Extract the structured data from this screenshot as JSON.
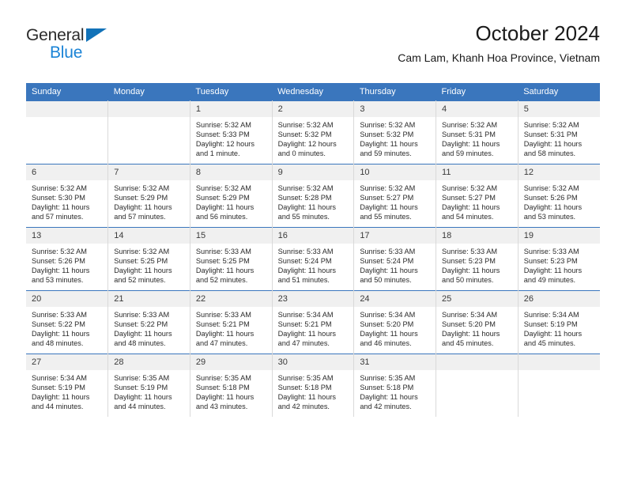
{
  "brand": {
    "name_part1": "General",
    "name_part2": "Blue",
    "logo_icon": "triangle-icon",
    "accent_blue": "#1a83d6",
    "triangle_blue": "#1272b8",
    "header_blue": "#3a76bd"
  },
  "header": {
    "title": "October 2024",
    "subtitle": "Cam Lam, Khanh Hoa Province, Vietnam"
  },
  "weekday_headers": [
    "Sunday",
    "Monday",
    "Tuesday",
    "Wednesday",
    "Thursday",
    "Friday",
    "Saturday"
  ],
  "weeks": [
    [
      {
        "day": "",
        "sunrise": "",
        "sunset": "",
        "daylight_line1": "",
        "daylight_line2": ""
      },
      {
        "day": "",
        "sunrise": "",
        "sunset": "",
        "daylight_line1": "",
        "daylight_line2": ""
      },
      {
        "day": "1",
        "sunrise": "Sunrise: 5:32 AM",
        "sunset": "Sunset: 5:33 PM",
        "daylight_line1": "Daylight: 12 hours",
        "daylight_line2": "and 1 minute."
      },
      {
        "day": "2",
        "sunrise": "Sunrise: 5:32 AM",
        "sunset": "Sunset: 5:32 PM",
        "daylight_line1": "Daylight: 12 hours",
        "daylight_line2": "and 0 minutes."
      },
      {
        "day": "3",
        "sunrise": "Sunrise: 5:32 AM",
        "sunset": "Sunset: 5:32 PM",
        "daylight_line1": "Daylight: 11 hours",
        "daylight_line2": "and 59 minutes."
      },
      {
        "day": "4",
        "sunrise": "Sunrise: 5:32 AM",
        "sunset": "Sunset: 5:31 PM",
        "daylight_line1": "Daylight: 11 hours",
        "daylight_line2": "and 59 minutes."
      },
      {
        "day": "5",
        "sunrise": "Sunrise: 5:32 AM",
        "sunset": "Sunset: 5:31 PM",
        "daylight_line1": "Daylight: 11 hours",
        "daylight_line2": "and 58 minutes."
      }
    ],
    [
      {
        "day": "6",
        "sunrise": "Sunrise: 5:32 AM",
        "sunset": "Sunset: 5:30 PM",
        "daylight_line1": "Daylight: 11 hours",
        "daylight_line2": "and 57 minutes."
      },
      {
        "day": "7",
        "sunrise": "Sunrise: 5:32 AM",
        "sunset": "Sunset: 5:29 PM",
        "daylight_line1": "Daylight: 11 hours",
        "daylight_line2": "and 57 minutes."
      },
      {
        "day": "8",
        "sunrise": "Sunrise: 5:32 AM",
        "sunset": "Sunset: 5:29 PM",
        "daylight_line1": "Daylight: 11 hours",
        "daylight_line2": "and 56 minutes."
      },
      {
        "day": "9",
        "sunrise": "Sunrise: 5:32 AM",
        "sunset": "Sunset: 5:28 PM",
        "daylight_line1": "Daylight: 11 hours",
        "daylight_line2": "and 55 minutes."
      },
      {
        "day": "10",
        "sunrise": "Sunrise: 5:32 AM",
        "sunset": "Sunset: 5:27 PM",
        "daylight_line1": "Daylight: 11 hours",
        "daylight_line2": "and 55 minutes."
      },
      {
        "day": "11",
        "sunrise": "Sunrise: 5:32 AM",
        "sunset": "Sunset: 5:27 PM",
        "daylight_line1": "Daylight: 11 hours",
        "daylight_line2": "and 54 minutes."
      },
      {
        "day": "12",
        "sunrise": "Sunrise: 5:32 AM",
        "sunset": "Sunset: 5:26 PM",
        "daylight_line1": "Daylight: 11 hours",
        "daylight_line2": "and 53 minutes."
      }
    ],
    [
      {
        "day": "13",
        "sunrise": "Sunrise: 5:32 AM",
        "sunset": "Sunset: 5:26 PM",
        "daylight_line1": "Daylight: 11 hours",
        "daylight_line2": "and 53 minutes."
      },
      {
        "day": "14",
        "sunrise": "Sunrise: 5:32 AM",
        "sunset": "Sunset: 5:25 PM",
        "daylight_line1": "Daylight: 11 hours",
        "daylight_line2": "and 52 minutes."
      },
      {
        "day": "15",
        "sunrise": "Sunrise: 5:33 AM",
        "sunset": "Sunset: 5:25 PM",
        "daylight_line1": "Daylight: 11 hours",
        "daylight_line2": "and 52 minutes."
      },
      {
        "day": "16",
        "sunrise": "Sunrise: 5:33 AM",
        "sunset": "Sunset: 5:24 PM",
        "daylight_line1": "Daylight: 11 hours",
        "daylight_line2": "and 51 minutes."
      },
      {
        "day": "17",
        "sunrise": "Sunrise: 5:33 AM",
        "sunset": "Sunset: 5:24 PM",
        "daylight_line1": "Daylight: 11 hours",
        "daylight_line2": "and 50 minutes."
      },
      {
        "day": "18",
        "sunrise": "Sunrise: 5:33 AM",
        "sunset": "Sunset: 5:23 PM",
        "daylight_line1": "Daylight: 11 hours",
        "daylight_line2": "and 50 minutes."
      },
      {
        "day": "19",
        "sunrise": "Sunrise: 5:33 AM",
        "sunset": "Sunset: 5:23 PM",
        "daylight_line1": "Daylight: 11 hours",
        "daylight_line2": "and 49 minutes."
      }
    ],
    [
      {
        "day": "20",
        "sunrise": "Sunrise: 5:33 AM",
        "sunset": "Sunset: 5:22 PM",
        "daylight_line1": "Daylight: 11 hours",
        "daylight_line2": "and 48 minutes."
      },
      {
        "day": "21",
        "sunrise": "Sunrise: 5:33 AM",
        "sunset": "Sunset: 5:22 PM",
        "daylight_line1": "Daylight: 11 hours",
        "daylight_line2": "and 48 minutes."
      },
      {
        "day": "22",
        "sunrise": "Sunrise: 5:33 AM",
        "sunset": "Sunset: 5:21 PM",
        "daylight_line1": "Daylight: 11 hours",
        "daylight_line2": "and 47 minutes."
      },
      {
        "day": "23",
        "sunrise": "Sunrise: 5:34 AM",
        "sunset": "Sunset: 5:21 PM",
        "daylight_line1": "Daylight: 11 hours",
        "daylight_line2": "and 47 minutes."
      },
      {
        "day": "24",
        "sunrise": "Sunrise: 5:34 AM",
        "sunset": "Sunset: 5:20 PM",
        "daylight_line1": "Daylight: 11 hours",
        "daylight_line2": "and 46 minutes."
      },
      {
        "day": "25",
        "sunrise": "Sunrise: 5:34 AM",
        "sunset": "Sunset: 5:20 PM",
        "daylight_line1": "Daylight: 11 hours",
        "daylight_line2": "and 45 minutes."
      },
      {
        "day": "26",
        "sunrise": "Sunrise: 5:34 AM",
        "sunset": "Sunset: 5:19 PM",
        "daylight_line1": "Daylight: 11 hours",
        "daylight_line2": "and 45 minutes."
      }
    ],
    [
      {
        "day": "27",
        "sunrise": "Sunrise: 5:34 AM",
        "sunset": "Sunset: 5:19 PM",
        "daylight_line1": "Daylight: 11 hours",
        "daylight_line2": "and 44 minutes."
      },
      {
        "day": "28",
        "sunrise": "Sunrise: 5:35 AM",
        "sunset": "Sunset: 5:19 PM",
        "daylight_line1": "Daylight: 11 hours",
        "daylight_line2": "and 44 minutes."
      },
      {
        "day": "29",
        "sunrise": "Sunrise: 5:35 AM",
        "sunset": "Sunset: 5:18 PM",
        "daylight_line1": "Daylight: 11 hours",
        "daylight_line2": "and 43 minutes."
      },
      {
        "day": "30",
        "sunrise": "Sunrise: 5:35 AM",
        "sunset": "Sunset: 5:18 PM",
        "daylight_line1": "Daylight: 11 hours",
        "daylight_line2": "and 42 minutes."
      },
      {
        "day": "31",
        "sunrise": "Sunrise: 5:35 AM",
        "sunset": "Sunset: 5:18 PM",
        "daylight_line1": "Daylight: 11 hours",
        "daylight_line2": "and 42 minutes."
      },
      {
        "day": "",
        "sunrise": "",
        "sunset": "",
        "daylight_line1": "",
        "daylight_line2": ""
      },
      {
        "day": "",
        "sunrise": "",
        "sunset": "",
        "daylight_line1": "",
        "daylight_line2": ""
      }
    ]
  ]
}
